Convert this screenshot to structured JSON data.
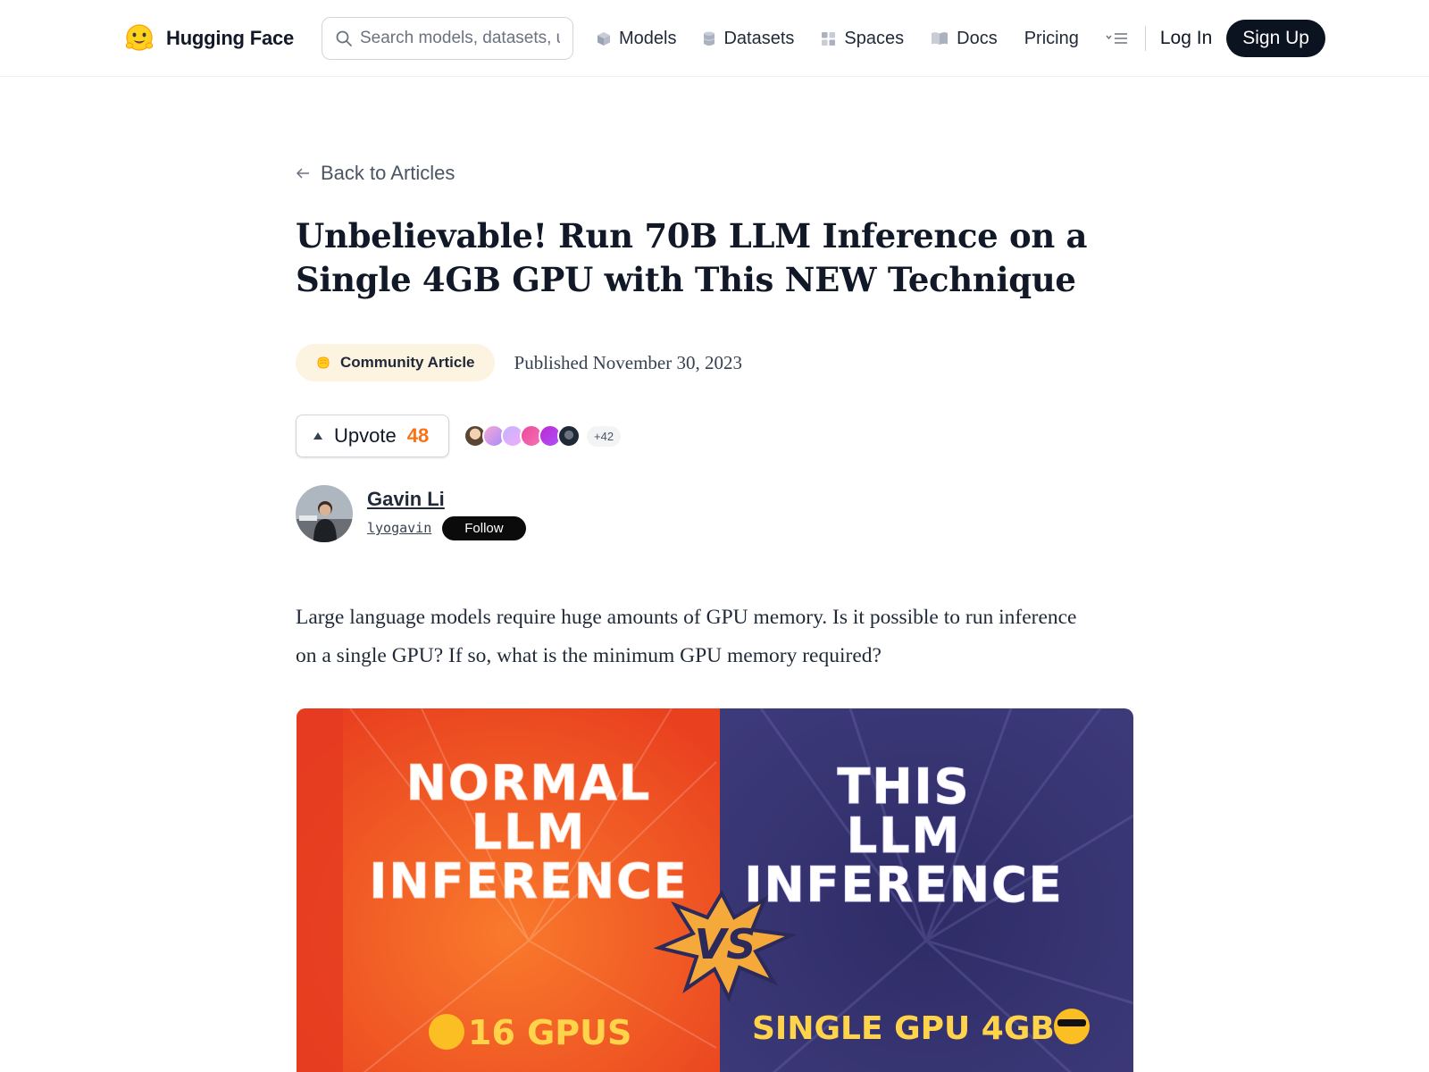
{
  "header": {
    "brand": "Hugging Face",
    "search_placeholder": "Search models, datasets, users...",
    "nav": [
      {
        "label": "Models",
        "icon": "cube-icon"
      },
      {
        "label": "Datasets",
        "icon": "database-icon"
      },
      {
        "label": "Spaces",
        "icon": "grid-icon"
      },
      {
        "label": "Docs",
        "icon": "book-icon"
      },
      {
        "label": "Pricing"
      }
    ],
    "menu_icon": "menu-icon",
    "login": "Log In",
    "signup": "Sign Up"
  },
  "article": {
    "back_label": "Back to Articles",
    "title": "Unbelievable! Run 70B LLM Inference on a Single 4GB GPU with This NEW Technique",
    "badge": "Community Article",
    "published": "Published November 30, 2023",
    "upvote_label": "Upvote",
    "upvote_count": "48",
    "voters_more": "+42",
    "author": {
      "name": "Gavin Li",
      "handle": "lyogavin",
      "follow_label": "Follow"
    },
    "intro": "Large language models require huge amounts of GPU memory. Is it possible to run inference on a single GPU? If so, what is the minimum GPU memory required?",
    "hero": {
      "left_title": [
        "NORMAL",
        "LLM",
        "INFERENCE"
      ],
      "right_title": [
        "THIS",
        "LLM",
        "INFERENCE"
      ],
      "vs": "VS",
      "left_caption": "16 GPUS",
      "right_caption": "SINGLE GPU 4GB",
      "left_color": "#f0441f",
      "right_color": "#34326a"
    }
  }
}
